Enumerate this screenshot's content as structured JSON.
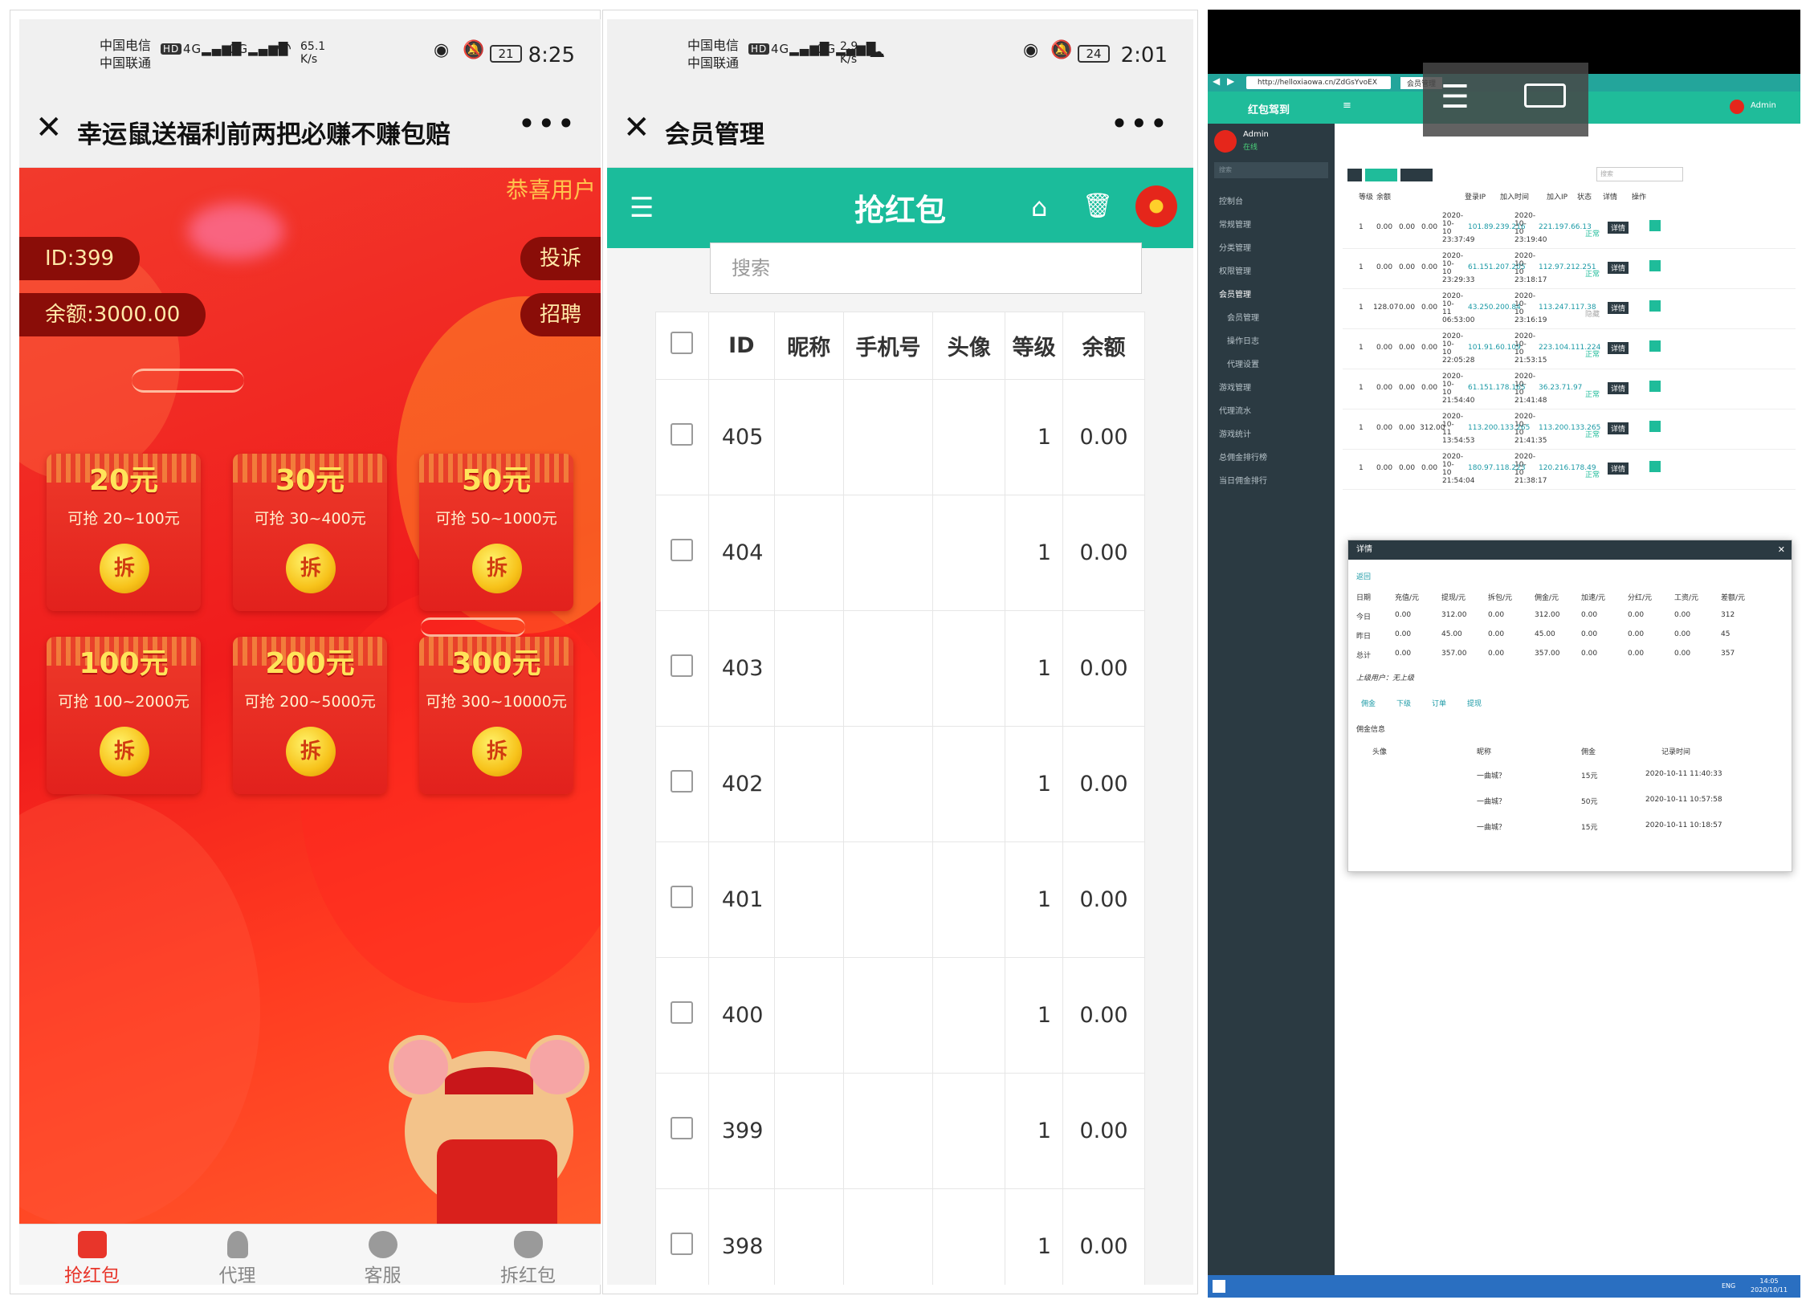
{
  "phone1": {
    "status": {
      "carrier1": "中国电信",
      "carrier2": "中国联通",
      "hd": "HD",
      "net1": "4G",
      "net2": "3G",
      "speed": "65.1",
      "speed_unit": "K/s",
      "battery": "21",
      "time": "8:25"
    },
    "title": "幸运鼠送福利前两把必赚不赚包赔",
    "congrats": "恭喜用户",
    "id_label": "ID:399",
    "balance_label": "余额:3000.00",
    "complain": "投诉",
    "recruit": "招聘",
    "open_char": "拆",
    "cards": [
      {
        "amount": "20元",
        "range": "可抢 20~100元"
      },
      {
        "amount": "30元",
        "range": "可抢 30~400元"
      },
      {
        "amount": "50元",
        "range": "可抢 50~1000元"
      },
      {
        "amount": "100元",
        "range": "可抢 100~2000元"
      },
      {
        "amount": "200元",
        "range": "可抢 200~5000元"
      },
      {
        "amount": "300元",
        "range": "可抢 300~10000元"
      }
    ],
    "tabs": [
      "抢红包",
      "代理",
      "客服",
      "拆红包"
    ],
    "colors": {
      "accent": "#e8352a",
      "bg": "#f01c1c",
      "coin": "#f7c21a"
    }
  },
  "phone2": {
    "status": {
      "carrier1": "中国电信",
      "carrier2": "中国联通",
      "hd": "HD",
      "net1": "4G",
      "net2": "3G",
      "speed": "2.9",
      "speed_unit": "K/s",
      "battery": "24",
      "time": "2:01"
    },
    "title": "会员管理",
    "header_title": "抢红包",
    "search_placeholder": "搜索",
    "columns": [
      "ID",
      "昵称",
      "手机号",
      "头像",
      "等级",
      "余额"
    ],
    "rows": [
      {
        "id": "405",
        "level": "1",
        "balance": "0.00"
      },
      {
        "id": "404",
        "level": "1",
        "balance": "0.00"
      },
      {
        "id": "403",
        "level": "1",
        "balance": "0.00"
      },
      {
        "id": "402",
        "level": "1",
        "balance": "0.00"
      },
      {
        "id": "401",
        "level": "1",
        "balance": "0.00"
      },
      {
        "id": "400",
        "level": "1",
        "balance": "0.00"
      },
      {
        "id": "399",
        "level": "1",
        "balance": "0.00"
      },
      {
        "id": "398",
        "level": "1",
        "balance": "0.00"
      }
    ],
    "colors": {
      "header": "#1bbc9b"
    }
  },
  "desktop": {
    "url": "http://helloxiaowa.cn/ZdGsYvoEX",
    "tab": "会员管理",
    "app_title": "红包驾到",
    "admin": "Admin",
    "online": "在线",
    "search_ph": "搜索",
    "sidebar": [
      "控制台",
      "常规管理",
      "分类管理",
      "权限管理",
      "会员管理",
      "会员管理",
      "操作日志",
      "代理设置",
      "游戏管理",
      "代理流水",
      "游戏统计",
      "总佣金排行榜",
      "当日佣金排行"
    ],
    "headers": [
      "等级",
      "余额",
      "登录IP",
      "加入时间",
      "加入IP",
      "状态",
      "详情",
      "操作"
    ],
    "rows": [
      {
        "level": "1",
        "bal": "0.00",
        "a": "0.00",
        "b": "0.00",
        "t1": "2020-10-10 23:37:49",
        "ip": "101.89.239.216",
        "t2": "2020-10-10 23:19:40",
        "ip2": "221.197.66.13",
        "st": "正常"
      },
      {
        "level": "1",
        "bal": "0.00",
        "a": "0.00",
        "b": "0.00",
        "t1": "2020-10-10 23:29:33",
        "ip": "61.151.207.205",
        "t2": "2020-10-10 23:18:17",
        "ip2": "112.97.212.251",
        "st": "正常"
      },
      {
        "level": "1",
        "bal": "128.07",
        "a": "0.00",
        "b": "0.00",
        "t1": "2020-10-11 06:53:00",
        "ip": "43.250.200.84",
        "t2": "2020-10-10 23:16:19",
        "ip2": "113.247.117.38",
        "st": "隐藏"
      },
      {
        "level": "1",
        "bal": "0.00",
        "a": "0.00",
        "b": "0.00",
        "t1": "2020-10-10 22:05:28",
        "ip": "101.91.60.109",
        "t2": "2020-10-10 21:53:15",
        "ip2": "223.104.111.224",
        "st": "正常"
      },
      {
        "level": "1",
        "bal": "0.00",
        "a": "0.00",
        "b": "0.00",
        "t1": "2020-10-10 21:54:40",
        "ip": "61.151.178.165",
        "t2": "2020-10-10 21:41:48",
        "ip2": "36.23.71.97",
        "st": "正常"
      },
      {
        "level": "1",
        "bal": "0.00",
        "a": "0.00",
        "b": "312.00",
        "t1": "2020-10-11 13:54:53",
        "ip": "113.200.133.265",
        "t2": "2020-10-10 21:41:35",
        "ip2": "113.200.133.265",
        "st": "正常"
      },
      {
        "level": "1",
        "bal": "0.00",
        "a": "0.00",
        "b": "0.00",
        "t1": "2020-10-10 21:54:04",
        "ip": "180.97.118.223",
        "t2": "2020-10-10 21:38:17",
        "ip2": "120.216.178.49",
        "st": "正常"
      }
    ],
    "detail_btn": "详情",
    "modal": {
      "title": "详情",
      "back": "返回",
      "heads": [
        "日期",
        "充值/元",
        "提现/元",
        "拆包/元",
        "佣金/元",
        "加速/元",
        "分红/元",
        "工资/元",
        "差额/元"
      ],
      "rows": [
        [
          "今日",
          "0.00",
          "312.00",
          "0.00",
          "312.00",
          "0.00",
          "0.00",
          "0.00",
          "312"
        ],
        [
          "昨日",
          "0.00",
          "45.00",
          "0.00",
          "45.00",
          "0.00",
          "0.00",
          "0.00",
          "45"
        ],
        [
          "总计",
          "0.00",
          "357.00",
          "0.00",
          "357.00",
          "0.00",
          "0.00",
          "0.00",
          "357"
        ]
      ],
      "parent": "上级用户：无上级",
      "tabs": [
        "佣金",
        "下级",
        "订单",
        "提现"
      ],
      "section": "佣金信息",
      "sub_heads": [
        "头像",
        "昵称",
        "佣金",
        "记录时间"
      ],
      "sub_rows": [
        [
          "一曲城？",
          "15元",
          "2020-10-11 11:40:33"
        ],
        [
          "一曲城？",
          "50元",
          "2020-10-11 10:57:58"
        ],
        [
          "一曲城？",
          "15元",
          "2020-10-11 10:18:57"
        ]
      ]
    },
    "clock": "14:05",
    "date": "2020/10/11",
    "lang": "ENG"
  }
}
